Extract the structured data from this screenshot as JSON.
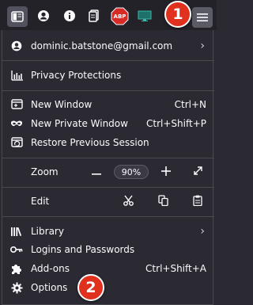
{
  "toolbar": {
    "abp_label": "ABP"
  },
  "badges": {
    "one": "1",
    "two": "2"
  },
  "menu": {
    "account": "dominic.batstone@gmail.com",
    "privacy": "Privacy Protections",
    "new_window": {
      "label": "New Window",
      "shortcut": "Ctrl+N"
    },
    "new_private": {
      "label": "New Private Window",
      "shortcut": "Ctrl+Shift+P"
    },
    "restore": "Restore Previous Session",
    "zoom": {
      "label": "Zoom",
      "value": "90%"
    },
    "edit": "Edit",
    "library": "Library",
    "logins": "Logins and Passwords",
    "addons": {
      "label": "Add-ons",
      "shortcut": "Ctrl+Shift+A"
    },
    "options": "Options"
  },
  "colors": {
    "background": "#2b2a33",
    "toolbar": "#232229",
    "badge": "#e0301e",
    "abp_red": "#d72a26"
  }
}
